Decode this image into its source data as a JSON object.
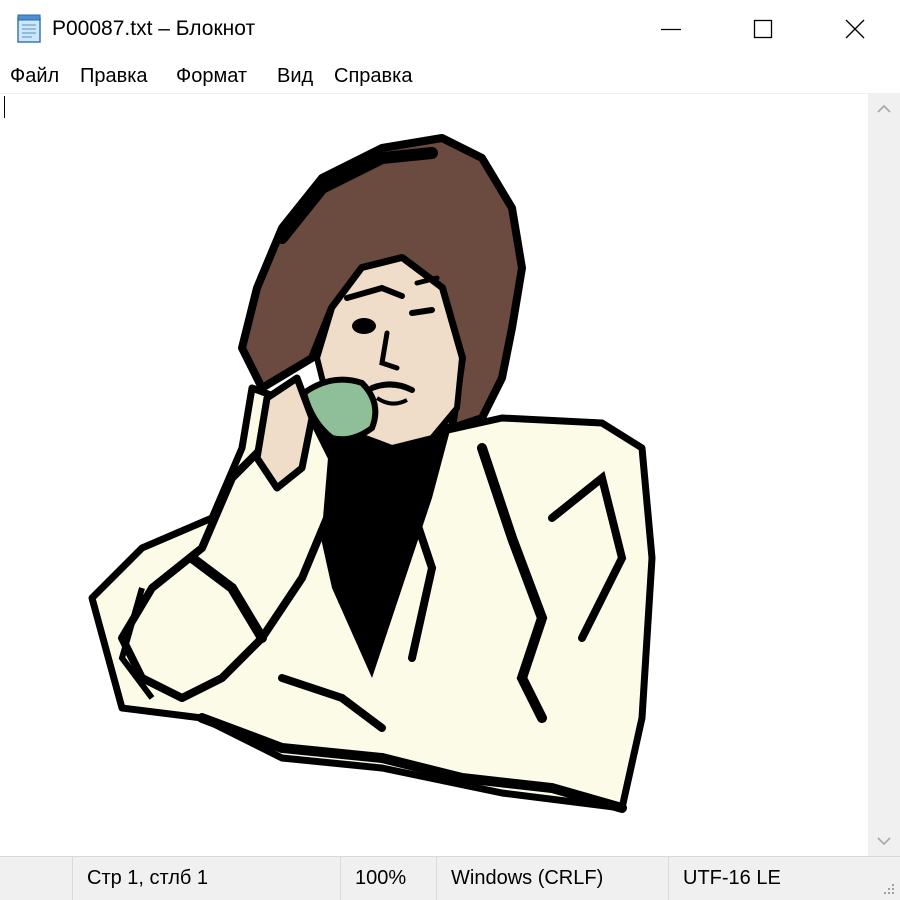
{
  "window": {
    "title": "P00087.txt – Блокнот",
    "app_icon": "notepad-icon",
    "controls": [
      "minimize-icon",
      "maximize-icon",
      "close-icon"
    ]
  },
  "menu": {
    "items": [
      "Файл",
      "Правка",
      "Формат",
      "Вид",
      "Справка"
    ]
  },
  "editor": {
    "content_image": "clip-art-woman-on-telephone",
    "colors": {
      "ink": "#000000",
      "skin": "#efdcc9",
      "hair": "#6b4a40",
      "jacket": "#fbfbe8",
      "phone": "#8fbf98"
    }
  },
  "scrollbar": {
    "up_icon": "chevron-up-icon",
    "down_icon": "chevron-down-icon"
  },
  "status": {
    "position": "Стр 1, стлб 1",
    "zoom": "100%",
    "line_ending": "Windows (CRLF)",
    "encoding": "UTF-16 LE"
  }
}
